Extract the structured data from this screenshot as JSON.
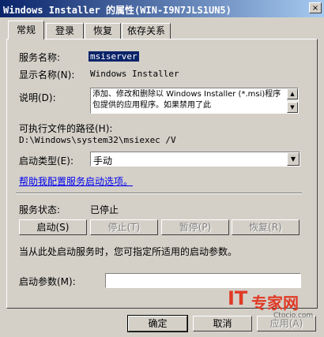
{
  "window": {
    "title": "Windows Installer 的属性(WIN-I9N7JLS1UN5)",
    "close_label": "×"
  },
  "tabs": [
    {
      "label": "常规",
      "active": true
    },
    {
      "label": "登录"
    },
    {
      "label": "恢复"
    },
    {
      "label": "依存关系"
    }
  ],
  "service": {
    "name_label": "服务名称:",
    "name_value": "msiserver",
    "display_label": "显示名称(N):",
    "display_value": "Windows Installer",
    "desc_label": "说明(D):",
    "desc_value": "添加、修改和删除以 Windows Installer (*.msi)程序包提供的应用程序。如果禁用了此",
    "path_label": "可执行文件的路径(H):",
    "path_value": "D:\\Windows\\system32\\msiexec /V",
    "startup_label": "启动类型(E):",
    "startup_value": "手动",
    "help_link": "帮助我配置服务启动选项。",
    "status_label": "服务状态:",
    "status_value": "已停止"
  },
  "control_buttons": {
    "start": "启动(S)",
    "stop": "停止(T)",
    "pause": "暂停(P)",
    "resume": "恢复(R)"
  },
  "start_params": {
    "hint": "当从此处启动服务时，您可指定所适用的启动参数。",
    "label": "启动参数(M):",
    "value": ""
  },
  "footer": {
    "ok": "确定",
    "cancel": "取消",
    "apply": "应用(A)"
  },
  "watermark": {
    "brand": "IT",
    "brand_cn": "专家网",
    "site": "Ctocio.com"
  }
}
